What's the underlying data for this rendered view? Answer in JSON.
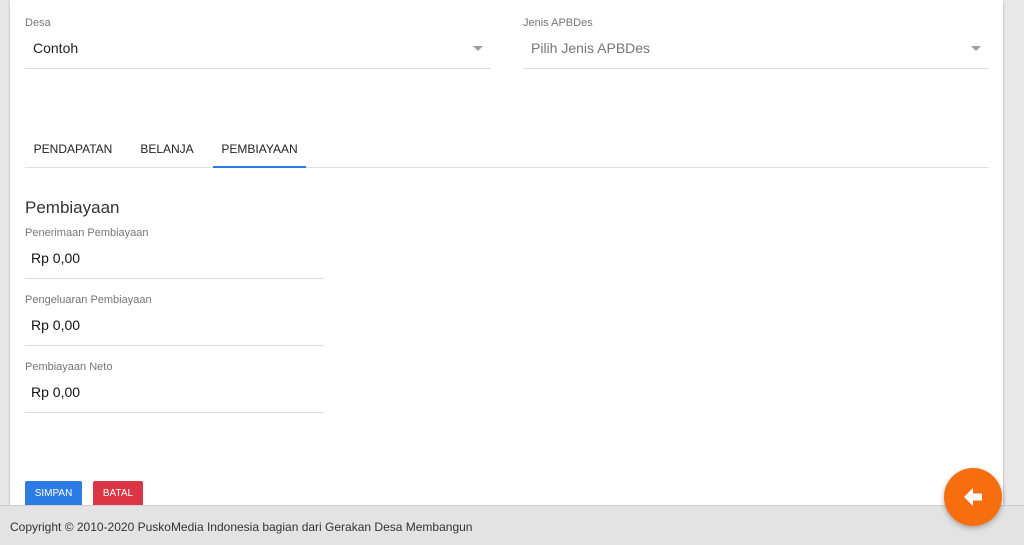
{
  "form": {
    "desa": {
      "label": "Desa",
      "value": "Contoh"
    },
    "jenis_apbdes": {
      "label": "Jenis APBDes",
      "placeholder": "Pilih Jenis APBDes"
    }
  },
  "tabs": [
    {
      "label": "PENDAPATAN",
      "active": false
    },
    {
      "label": "BELANJA",
      "active": false
    },
    {
      "label": "PEMBIAYAAN",
      "active": true
    }
  ],
  "section": {
    "title": "Pembiayaan",
    "fields": [
      {
        "label": "Penerimaan Pembiayaan",
        "value": "Rp 0,00"
      },
      {
        "label": "Pengeluaran Pembiayaan",
        "value": "Rp 0,00"
      },
      {
        "label": "Pembiayaan Neto",
        "value": "Rp 0,00"
      }
    ]
  },
  "buttons": {
    "save_label": "SIMPAN",
    "cancel_label": "BATAL"
  },
  "footer": {
    "text": "Copyright © 2010-2020 PuskoMedia Indonesia bagian dari Gerakan Desa Membangun"
  },
  "fab": {
    "icon": "arrow-left-icon"
  },
  "colors": {
    "accent": "#2c7be5",
    "danger": "#dc3545",
    "fab": "#f66e0d"
  }
}
